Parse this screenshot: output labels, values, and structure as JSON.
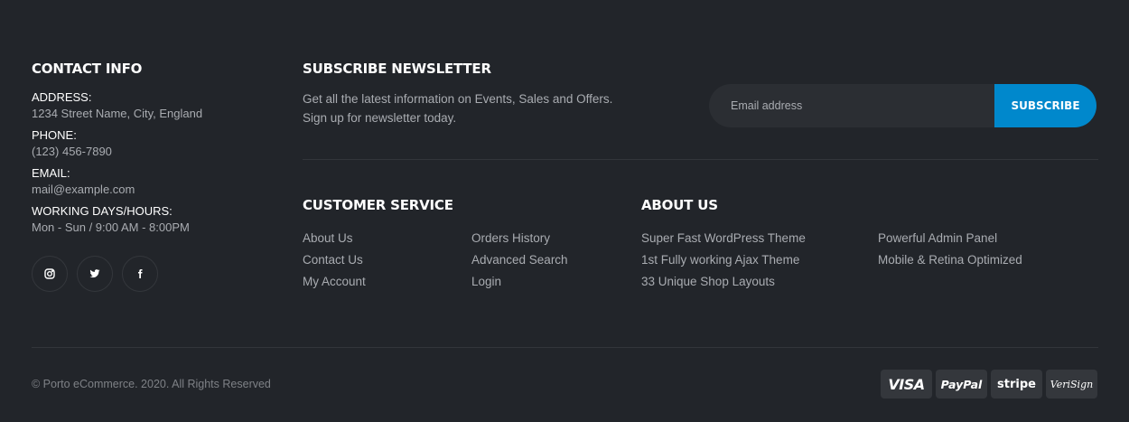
{
  "contact": {
    "heading": "CONTACT INFO",
    "items": [
      {
        "label": "ADDRESS:",
        "value": "1234 Street Name, City, England"
      },
      {
        "label": "PHONE:",
        "value": "(123) 456-7890"
      },
      {
        "label": "EMAIL:",
        "value": "mail@example.com"
      },
      {
        "label": "WORKING DAYS/HOURS:",
        "value": "Mon - Sun / 9:00 AM - 8:00PM"
      }
    ],
    "socials": [
      "instagram-icon",
      "twitter-icon",
      "facebook-icon"
    ]
  },
  "newsletter": {
    "heading": "SUBSCRIBE NEWSLETTER",
    "text_line1": "Get all the latest information on Events, Sales and Offers.",
    "text_line2": "Sign up for newsletter today.",
    "email_placeholder": "Email address",
    "button_label": "SUBSCRIBE",
    "button_color": "#0088cc"
  },
  "customer_service": {
    "heading": "CUSTOMER SERVICE",
    "links": [
      "About Us",
      "Contact Us",
      "My Account",
      "Orders History",
      "Advanced Search",
      "Login"
    ]
  },
  "about": {
    "heading": "ABOUT US",
    "links": [
      "Super Fast WordPress Theme",
      "1st Fully working Ajax Theme",
      "33 Unique Shop Layouts",
      "Powerful Admin Panel",
      "Mobile & Retina Optimized"
    ]
  },
  "footer": {
    "copyright": "© Porto eCommerce. 2020. All Rights Reserved",
    "payments": [
      "VISA",
      "PayPal",
      "stripe",
      "VeriSign"
    ]
  }
}
